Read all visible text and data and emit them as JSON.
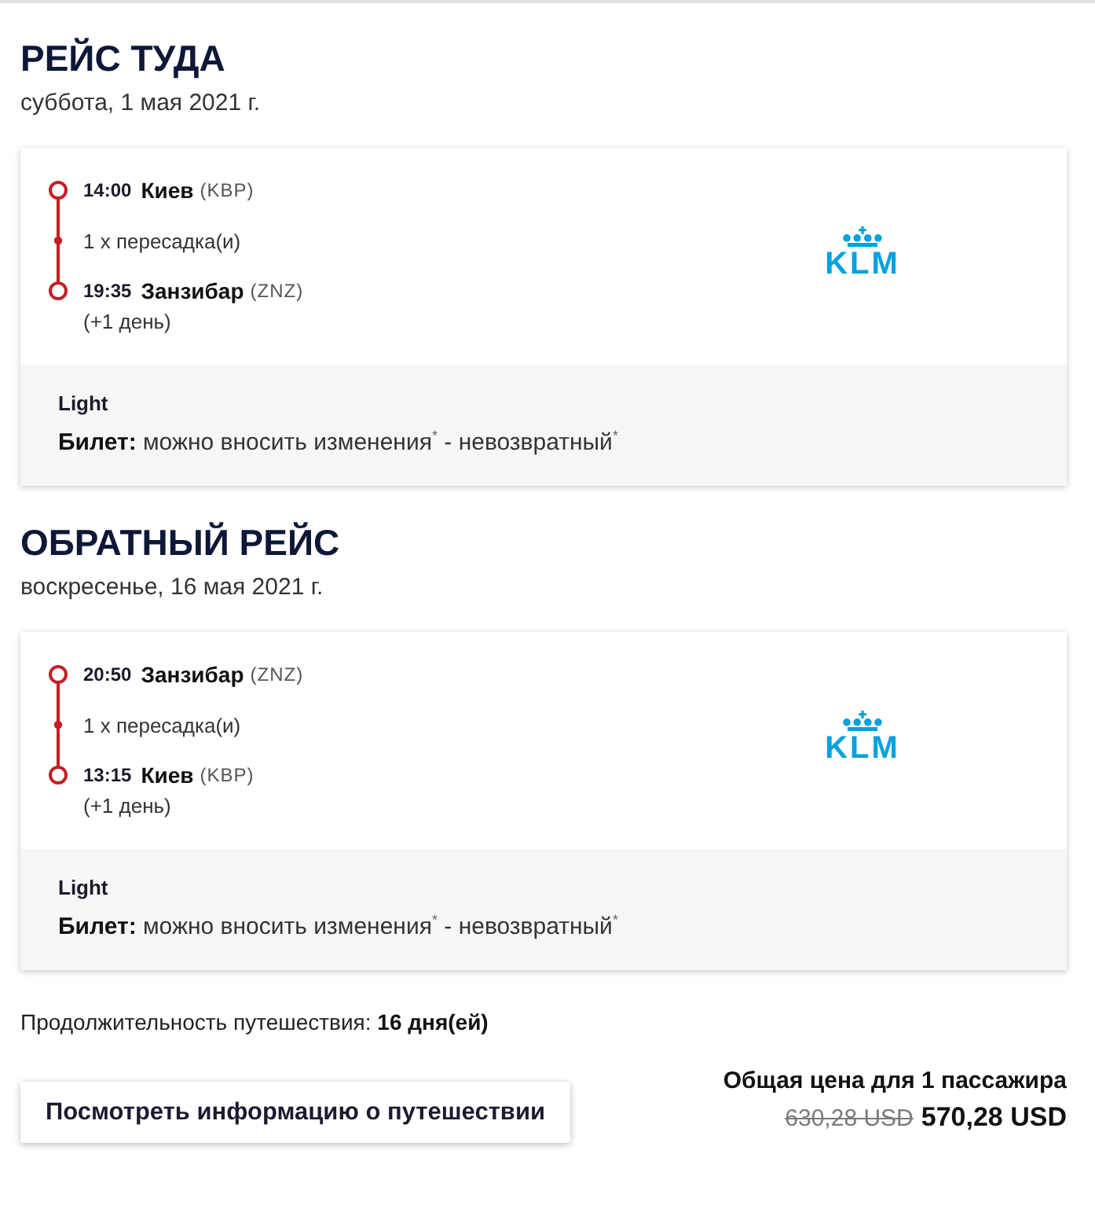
{
  "flights": [
    {
      "title": "РЕЙС ТУДА",
      "date": "суббота, 1 мая 2021 г.",
      "itinerary": [
        {
          "kind": "stop",
          "time": "14:00",
          "city": "Киев",
          "code": "(KBP)"
        },
        {
          "kind": "transfer",
          "text": "1 x пересадка(и)"
        },
        {
          "kind": "stop",
          "time": "19:35",
          "city": "Занзибар",
          "code": "(ZNZ)",
          "note": "(+1 день)"
        }
      ],
      "airline_logo": "KLM",
      "fare": {
        "name": "Light",
        "conditions": "**Билет:** можно вносить изменения$^{*}$ - невозвратный$^{*}$"
      }
    },
    {
      "title": "ОБРАТНЫЙ РЕЙС",
      "date": "воскресенье, 16 мая 2021 г.",
      "itinerary": [
        {
          "kind": "stop",
          "time": "20:50",
          "city": "Занзибар",
          "code": "(ZNZ)"
        },
        {
          "kind": "transfer",
          "text": "1 x пересадка(и)"
        },
        {
          "kind": "stop",
          "time": "13:15",
          "city": "Киев",
          "code": "(KBP)",
          "note": "(+1 день)"
        }
      ],
      "airline_logo": "KLM",
      "fare": {
        "name": "Light",
        "conditions": "**Билет:** можно вносить изменения$^{*}$ - невозвратный$^{*}$"
      }
    }
  ],
  "summary": {
    "duration": "Продолжительность путешествия: **16 дня(ей)**",
    "details_button": "Посмотреть информацию о путешествии",
    "price_label": "Общая цена для 1 пассажира",
    "old_price": "630,28 USD",
    "price": "570,28 USD"
  }
}
